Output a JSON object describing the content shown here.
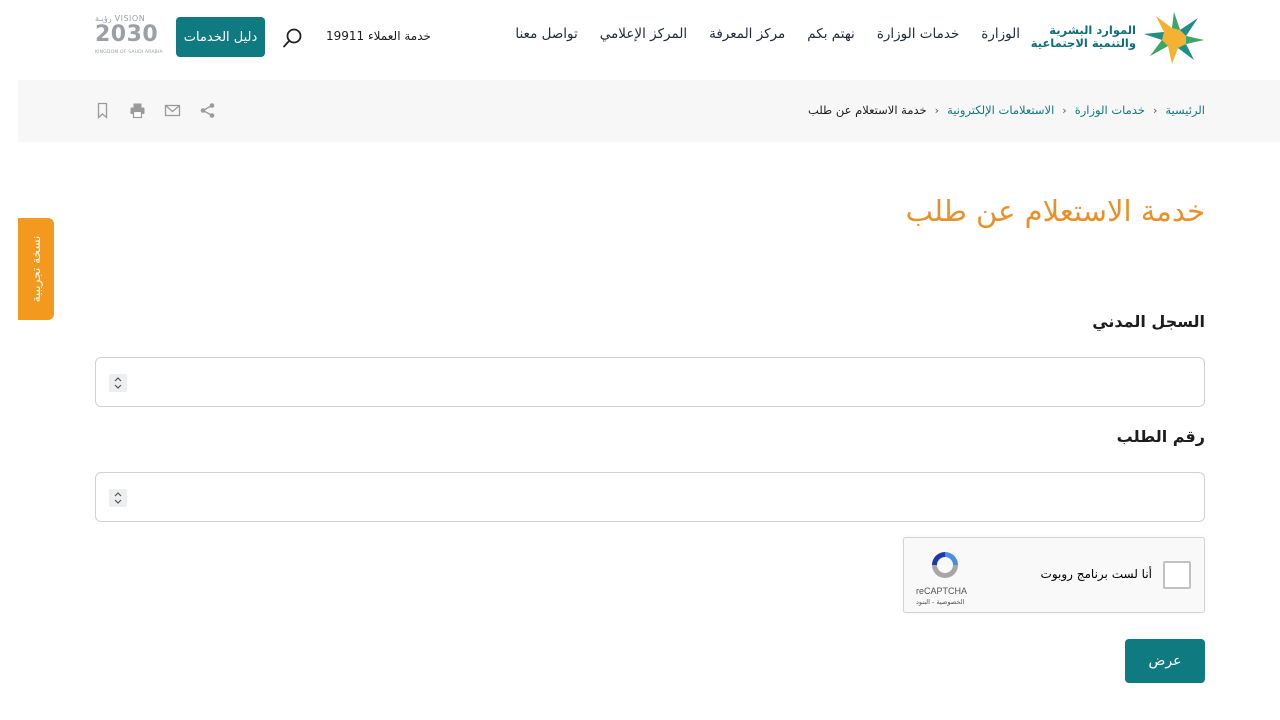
{
  "header": {
    "logo_line1": "الموارد البشرية",
    "logo_line2": "والتنمية الاجتماعية",
    "nav": [
      "الوزارة",
      "خدمات الوزارة",
      "نهتم بكم",
      "مركز المعرفة",
      "المركز الإعلامي",
      "تواصل معنا"
    ],
    "hotline": "خدمة العملاء 19911",
    "guide_button": "دليل الخدمات",
    "vision_top": "VISION رؤيـة",
    "vision_year": "2030",
    "vision_bottom": "KINGDOM OF SAUDI ARABIA"
  },
  "breadcrumb": {
    "items": [
      "الرئيسية",
      "خدمات الوزارة",
      "الاستعلامات الإلكترونية"
    ],
    "current": "خدمة الاستعلام عن طلب"
  },
  "beta_tab": "نسخة تجريبية",
  "main": {
    "title": "خدمة الاستعلام عن طلب",
    "field1_label": "السجل المدني",
    "field1_value": "",
    "field2_label": "رقم الطلب",
    "field2_value": "",
    "submit": "عرض"
  },
  "recaptcha": {
    "label": "أنا لست برنامج روبوت",
    "brand": "reCAPTCHA",
    "terms": "الخصوصية - البنود"
  },
  "colors": {
    "primary": "#0f7a80",
    "title_accent": "#e8912a",
    "beta_tab": "#f39a1e",
    "breadcrumb_band": "#f7f7f7"
  }
}
